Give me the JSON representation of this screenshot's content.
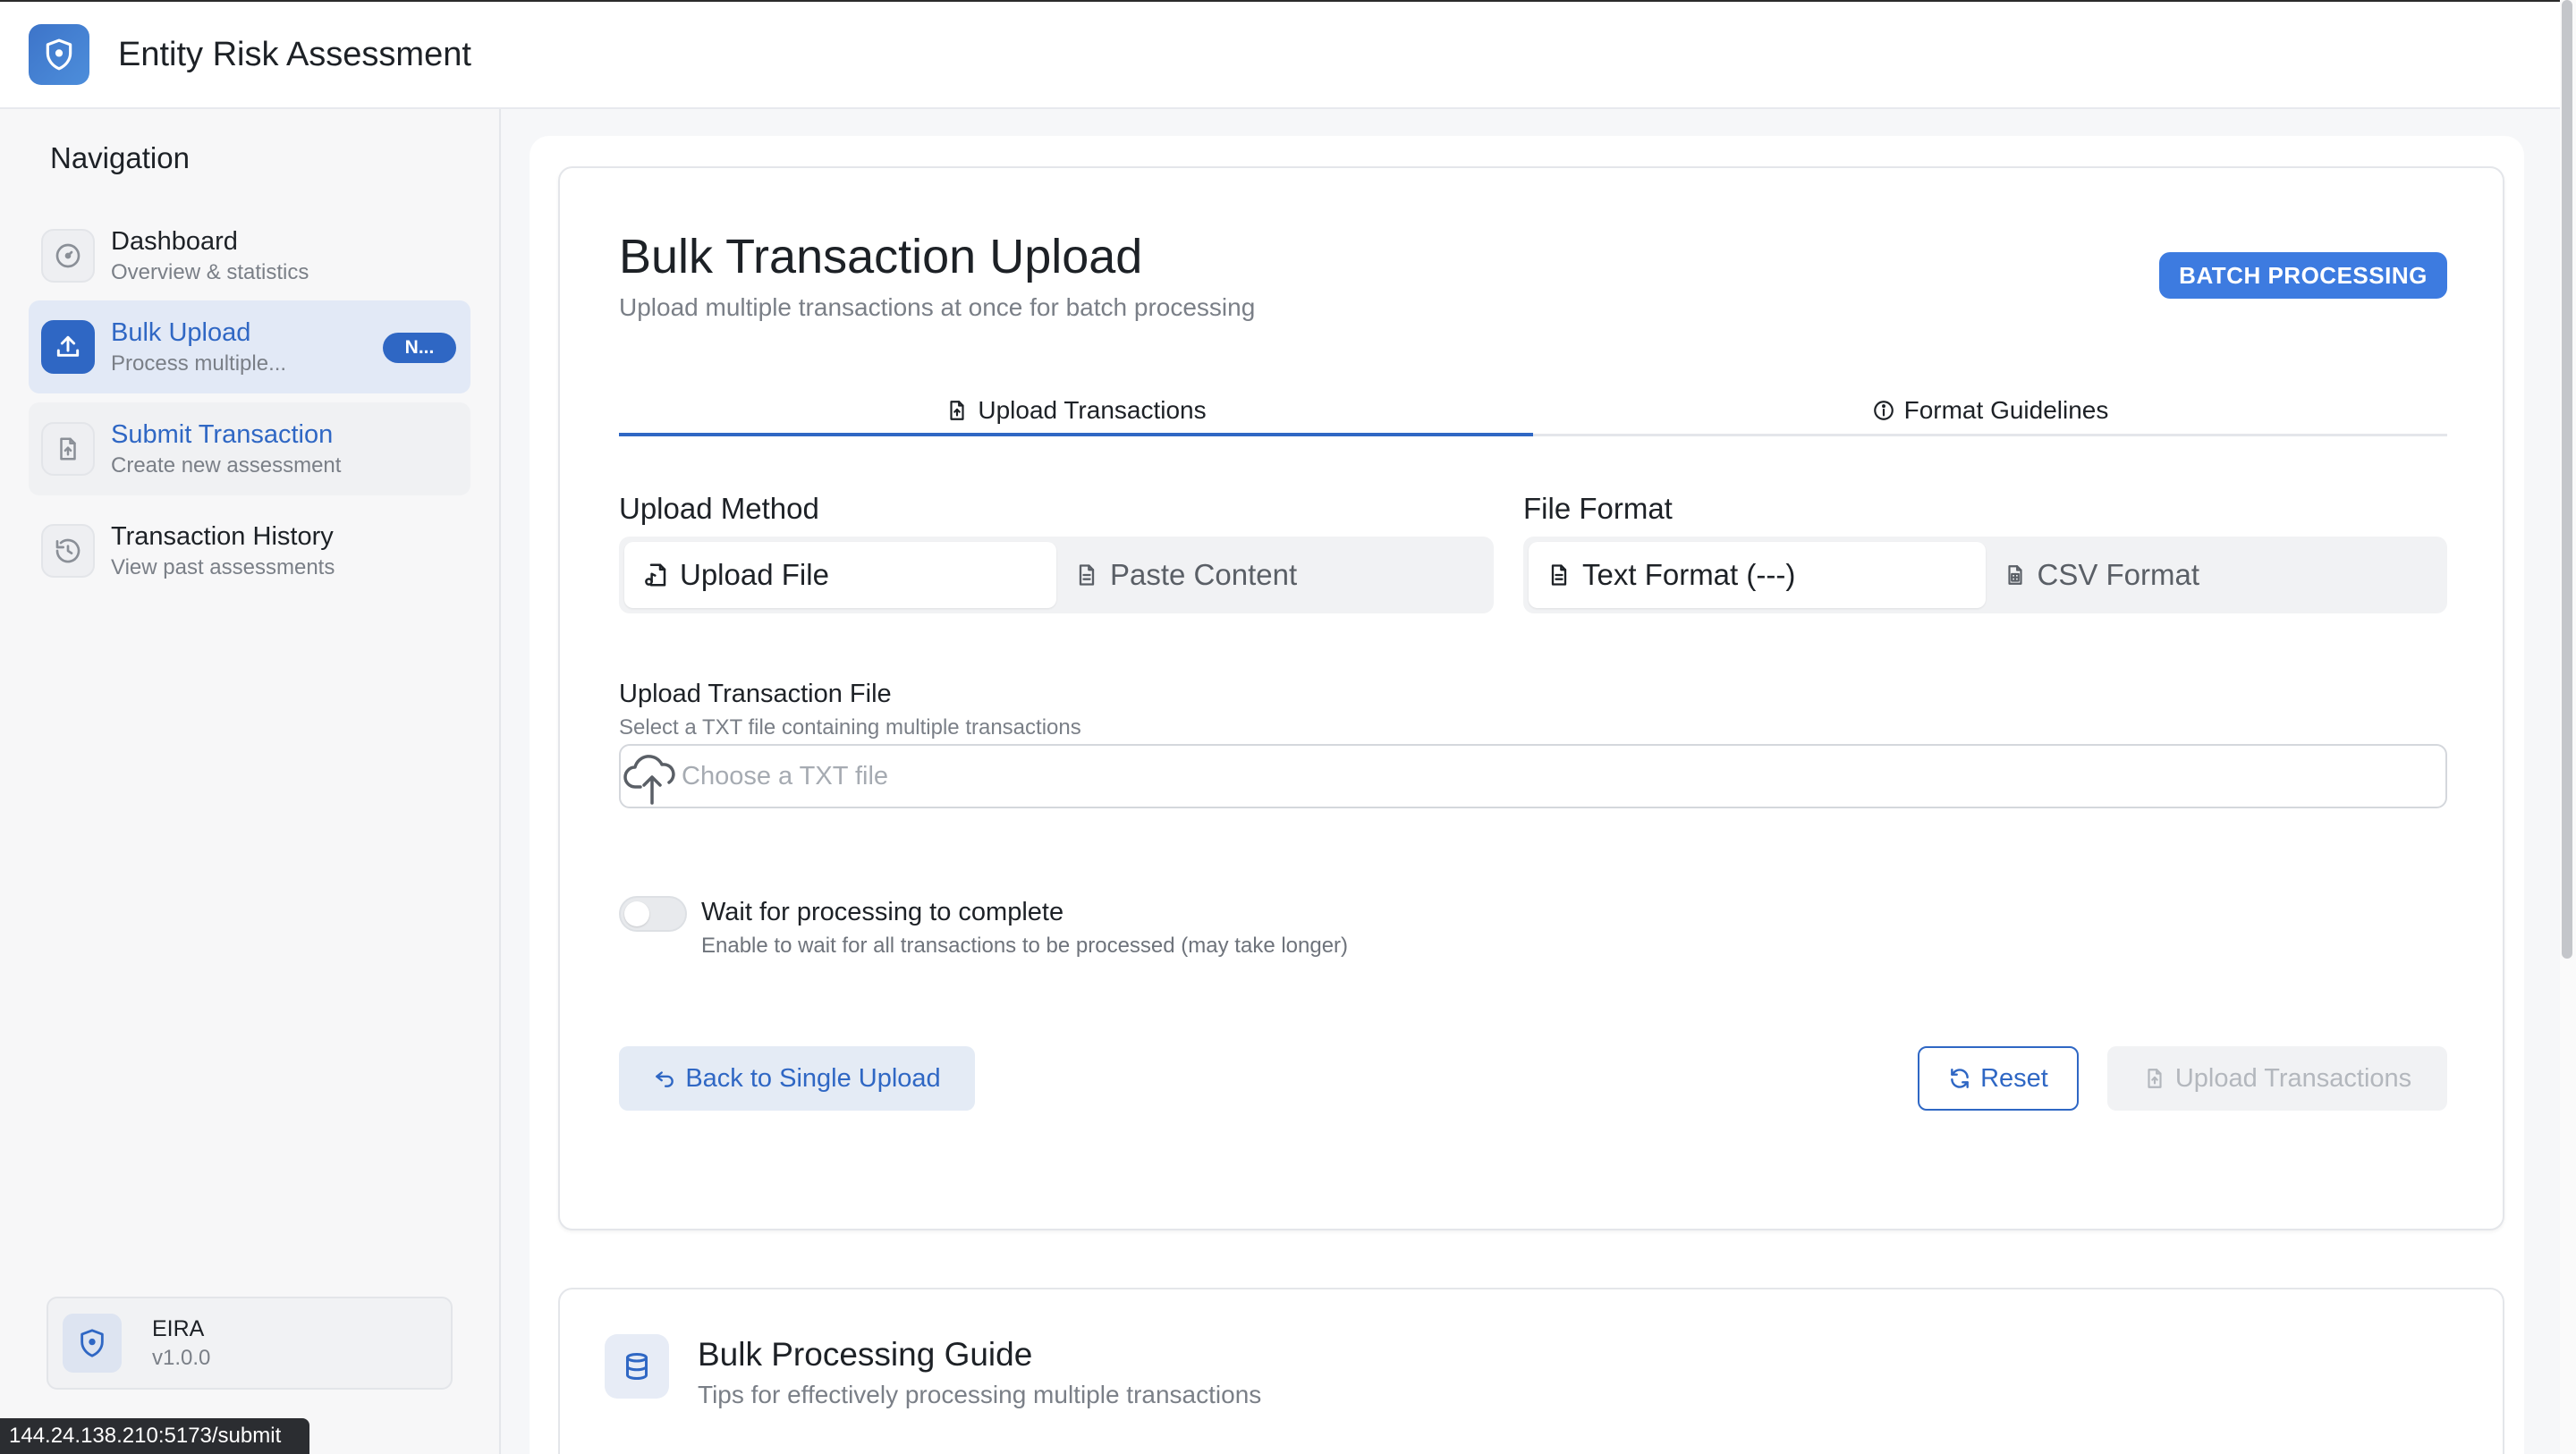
{
  "header": {
    "title": "Entity Risk Assessment"
  },
  "sidebar": {
    "heading": "Navigation",
    "items": [
      {
        "title": "Dashboard",
        "subtitle": "Overview & statistics",
        "icon": "gauge-icon"
      },
      {
        "title": "Bulk Upload",
        "subtitle": "Process multiple...",
        "icon": "upload-icon",
        "badge": "N...",
        "active": true
      },
      {
        "title": "Submit Transaction",
        "subtitle": "Create new assessment",
        "icon": "file-upload-icon"
      },
      {
        "title": "Transaction History",
        "subtitle": "View past assessments",
        "icon": "history-icon"
      }
    ],
    "app_name": "EIRA",
    "version": "v1.0.0"
  },
  "status_url": "144.24.138.210:5173/submit",
  "main": {
    "title": "Bulk Transaction Upload",
    "subtitle": "Upload multiple transactions at once for batch processing",
    "badge": "BATCH PROCESSING",
    "tabs": [
      {
        "label": "Upload Transactions",
        "icon": "file-upload-icon",
        "active": true
      },
      {
        "label": "Format Guidelines",
        "icon": "info-icon",
        "active": false
      }
    ],
    "upload_method": {
      "label": "Upload Method",
      "options": [
        {
          "label": "Upload File",
          "icon": "file-music-icon",
          "selected": true
        },
        {
          "label": "Paste Content",
          "icon": "document-icon",
          "selected": false
        }
      ]
    },
    "file_format": {
      "label": "File Format",
      "options": [
        {
          "label": "Text Format (---)",
          "icon": "document-icon",
          "selected": true
        },
        {
          "label": "CSV Format",
          "icon": "spreadsheet-icon",
          "selected": false
        }
      ]
    },
    "file_field": {
      "label": "Upload Transaction File",
      "description": "Select a TXT file containing multiple transactions",
      "placeholder": "Choose a TXT file"
    },
    "wait_toggle": {
      "label": "Wait for processing to complete",
      "description": "Enable to wait for all transactions to be processed (may take longer)",
      "enabled": false
    },
    "buttons": {
      "back": "Back to Single Upload",
      "reset": "Reset",
      "upload": "Upload Transactions"
    }
  },
  "guide": {
    "title": "Bulk Processing Guide",
    "subtitle": "Tips for effectively processing multiple transactions"
  },
  "colors": {
    "accent": "#2f67c4",
    "badge": "#3d7be0",
    "active_nav_bg": "#e2e9f6"
  }
}
